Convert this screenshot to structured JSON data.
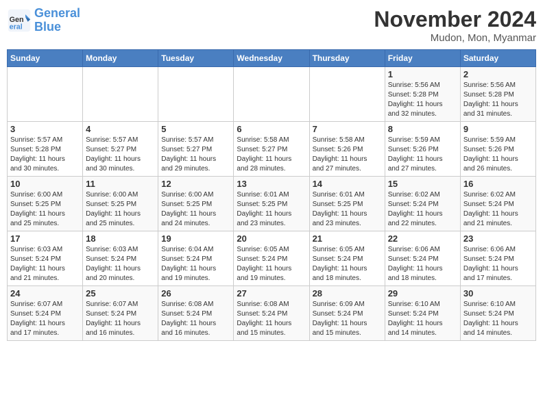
{
  "logo": {
    "line1": "General",
    "line2": "Blue"
  },
  "title": "November 2024",
  "subtitle": "Mudon, Mon, Myanmar",
  "days_header": [
    "Sunday",
    "Monday",
    "Tuesday",
    "Wednesday",
    "Thursday",
    "Friday",
    "Saturday"
  ],
  "weeks": [
    [
      {
        "day": "",
        "info": ""
      },
      {
        "day": "",
        "info": ""
      },
      {
        "day": "",
        "info": ""
      },
      {
        "day": "",
        "info": ""
      },
      {
        "day": "",
        "info": ""
      },
      {
        "day": "1",
        "info": "Sunrise: 5:56 AM\nSunset: 5:28 PM\nDaylight: 11 hours\nand 32 minutes."
      },
      {
        "day": "2",
        "info": "Sunrise: 5:56 AM\nSunset: 5:28 PM\nDaylight: 11 hours\nand 31 minutes."
      }
    ],
    [
      {
        "day": "3",
        "info": "Sunrise: 5:57 AM\nSunset: 5:28 PM\nDaylight: 11 hours\nand 30 minutes."
      },
      {
        "day": "4",
        "info": "Sunrise: 5:57 AM\nSunset: 5:27 PM\nDaylight: 11 hours\nand 30 minutes."
      },
      {
        "day": "5",
        "info": "Sunrise: 5:57 AM\nSunset: 5:27 PM\nDaylight: 11 hours\nand 29 minutes."
      },
      {
        "day": "6",
        "info": "Sunrise: 5:58 AM\nSunset: 5:27 PM\nDaylight: 11 hours\nand 28 minutes."
      },
      {
        "day": "7",
        "info": "Sunrise: 5:58 AM\nSunset: 5:26 PM\nDaylight: 11 hours\nand 27 minutes."
      },
      {
        "day": "8",
        "info": "Sunrise: 5:59 AM\nSunset: 5:26 PM\nDaylight: 11 hours\nand 27 minutes."
      },
      {
        "day": "9",
        "info": "Sunrise: 5:59 AM\nSunset: 5:26 PM\nDaylight: 11 hours\nand 26 minutes."
      }
    ],
    [
      {
        "day": "10",
        "info": "Sunrise: 6:00 AM\nSunset: 5:25 PM\nDaylight: 11 hours\nand 25 minutes."
      },
      {
        "day": "11",
        "info": "Sunrise: 6:00 AM\nSunset: 5:25 PM\nDaylight: 11 hours\nand 25 minutes."
      },
      {
        "day": "12",
        "info": "Sunrise: 6:00 AM\nSunset: 5:25 PM\nDaylight: 11 hours\nand 24 minutes."
      },
      {
        "day": "13",
        "info": "Sunrise: 6:01 AM\nSunset: 5:25 PM\nDaylight: 11 hours\nand 23 minutes."
      },
      {
        "day": "14",
        "info": "Sunrise: 6:01 AM\nSunset: 5:25 PM\nDaylight: 11 hours\nand 23 minutes."
      },
      {
        "day": "15",
        "info": "Sunrise: 6:02 AM\nSunset: 5:24 PM\nDaylight: 11 hours\nand 22 minutes."
      },
      {
        "day": "16",
        "info": "Sunrise: 6:02 AM\nSunset: 5:24 PM\nDaylight: 11 hours\nand 21 minutes."
      }
    ],
    [
      {
        "day": "17",
        "info": "Sunrise: 6:03 AM\nSunset: 5:24 PM\nDaylight: 11 hours\nand 21 minutes."
      },
      {
        "day": "18",
        "info": "Sunrise: 6:03 AM\nSunset: 5:24 PM\nDaylight: 11 hours\nand 20 minutes."
      },
      {
        "day": "19",
        "info": "Sunrise: 6:04 AM\nSunset: 5:24 PM\nDaylight: 11 hours\nand 19 minutes."
      },
      {
        "day": "20",
        "info": "Sunrise: 6:05 AM\nSunset: 5:24 PM\nDaylight: 11 hours\nand 19 minutes."
      },
      {
        "day": "21",
        "info": "Sunrise: 6:05 AM\nSunset: 5:24 PM\nDaylight: 11 hours\nand 18 minutes."
      },
      {
        "day": "22",
        "info": "Sunrise: 6:06 AM\nSunset: 5:24 PM\nDaylight: 11 hours\nand 18 minutes."
      },
      {
        "day": "23",
        "info": "Sunrise: 6:06 AM\nSunset: 5:24 PM\nDaylight: 11 hours\nand 17 minutes."
      }
    ],
    [
      {
        "day": "24",
        "info": "Sunrise: 6:07 AM\nSunset: 5:24 PM\nDaylight: 11 hours\nand 17 minutes."
      },
      {
        "day": "25",
        "info": "Sunrise: 6:07 AM\nSunset: 5:24 PM\nDaylight: 11 hours\nand 16 minutes."
      },
      {
        "day": "26",
        "info": "Sunrise: 6:08 AM\nSunset: 5:24 PM\nDaylight: 11 hours\nand 16 minutes."
      },
      {
        "day": "27",
        "info": "Sunrise: 6:08 AM\nSunset: 5:24 PM\nDaylight: 11 hours\nand 15 minutes."
      },
      {
        "day": "28",
        "info": "Sunrise: 6:09 AM\nSunset: 5:24 PM\nDaylight: 11 hours\nand 15 minutes."
      },
      {
        "day": "29",
        "info": "Sunrise: 6:10 AM\nSunset: 5:24 PM\nDaylight: 11 hours\nand 14 minutes."
      },
      {
        "day": "30",
        "info": "Sunrise: 6:10 AM\nSunset: 5:24 PM\nDaylight: 11 hours\nand 14 minutes."
      }
    ]
  ]
}
